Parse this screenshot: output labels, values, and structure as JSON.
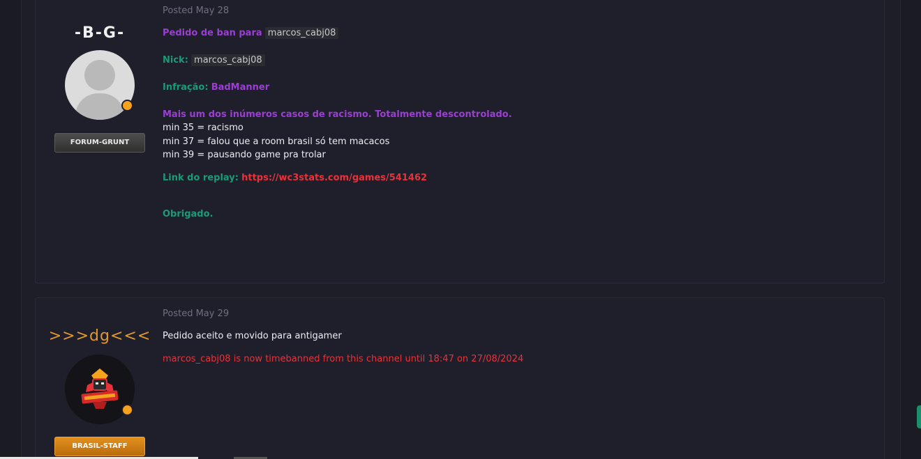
{
  "posts": [
    {
      "author": "-B-G-",
      "rank": "FORUM-GRUNT",
      "posted": "Posted May 28",
      "lines": {
        "request_prefix": "Pedido de ban para",
        "request_nick": "marcos_cabj08",
        "nick_label": "Nick:",
        "nick_value": "marcos_cabj08",
        "infraction_label": "Infração:",
        "infraction_value": "BadManner",
        "summary": "Mais um dos inúmeros casos de racismo. Totalmente descontrolado.",
        "detail_1": "min 35 = racismo",
        "detail_2": "min 37 = falou que a room brasil só tem macacos",
        "detail_3": "min 39 =  pausando game pra trolar",
        "replay_label": "Link do replay:",
        "replay_url": "https://wc3stats.com/games/541462",
        "thanks": "Obrigado."
      }
    },
    {
      "author": ">>>dg<<<",
      "rank": "BRASIL-STAFF",
      "posted": "Posted May 29",
      "lines": {
        "reply": "Pedido aceito e movido para antigamer",
        "ban_notice": "marcos_cabj08 is now timebanned from this channel until 18:47 on 27/08/2024"
      }
    }
  ],
  "colors": {
    "purple": "#9a3fd1",
    "green": "#1d9a75",
    "red": "#e8323a",
    "online": "#f5a21e",
    "staff_orange": "#e0972c"
  },
  "icons": {
    "avatar_default": "user-silhouette-icon",
    "avatar_logo": "mascot-logo-icon",
    "online_indicator": "online-dot-icon"
  }
}
